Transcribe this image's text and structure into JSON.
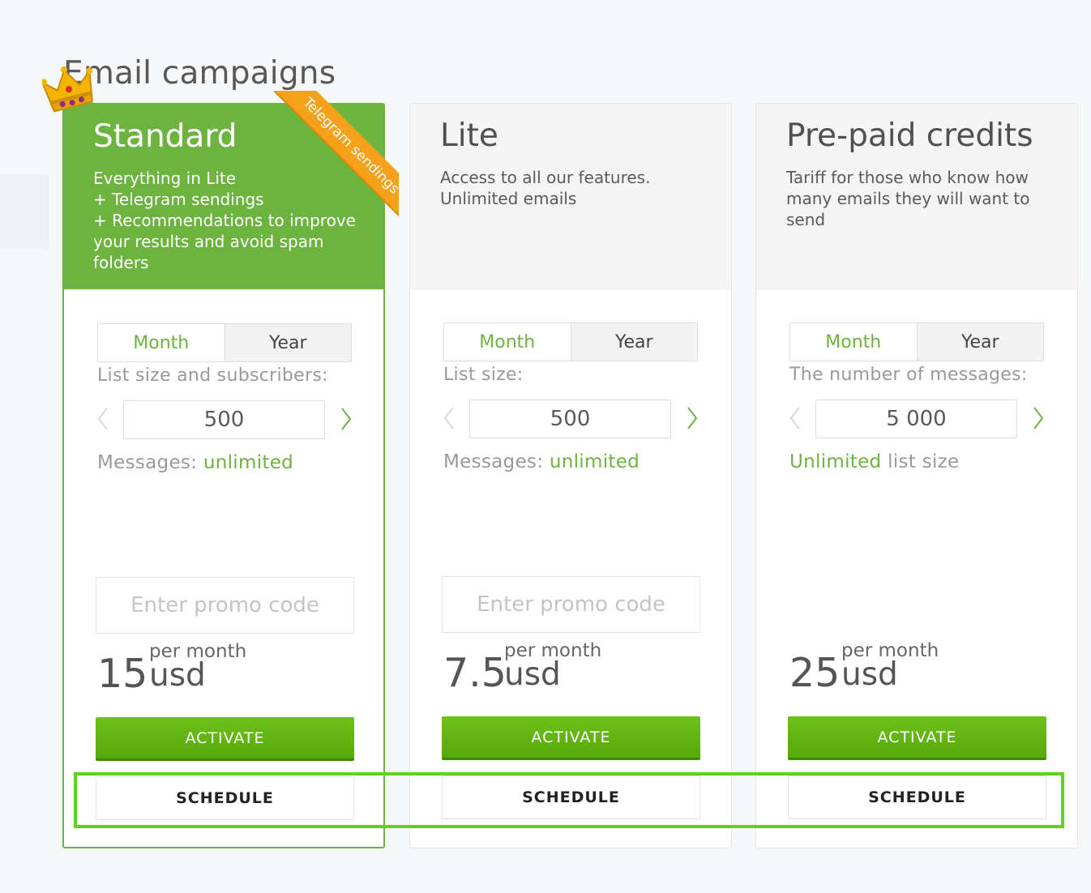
{
  "page": {
    "title": "Email campaigns"
  },
  "ribbon": {
    "text": "Telegram sendings"
  },
  "colors": {
    "accent": "#6db33f",
    "ribbon": "#f6a11a",
    "button": "#5fb513",
    "highlight": "#5fd11e"
  },
  "plans": [
    {
      "name": "Standard",
      "description": "Everything in Lite\n+ Telegram sendings\n+ Recommendations to improve your results and avoid spam folders",
      "period_month": "Month",
      "period_year": "Year",
      "field_label": "List size and subscribers:",
      "value": "500",
      "meta_prefix": "Messages: ",
      "meta_highlight": "unlimited",
      "meta_suffix": "",
      "promo_placeholder": "Enter promo code",
      "amount": "15",
      "per": "per month",
      "currency": "usd",
      "activate": "ACTIVATE",
      "schedule": "SCHEDULE"
    },
    {
      "name": "Lite",
      "description": "Access to all our features.\nUnlimited emails",
      "period_month": "Month",
      "period_year": "Year",
      "field_label": "List size:",
      "value": "500",
      "meta_prefix": "Messages: ",
      "meta_highlight": "unlimited",
      "meta_suffix": "",
      "promo_placeholder": "Enter promo code",
      "amount": "7.5",
      "per": "per month",
      "currency": "usd",
      "activate": "ACTIVATE",
      "schedule": "SCHEDULE"
    },
    {
      "name": "Pre-paid credits",
      "description": "Tariff for those who know how many emails they will want to send",
      "period_month": "Month",
      "period_year": "Year",
      "field_label": "The number of messages:",
      "value": "5 000",
      "meta_prefix": "",
      "meta_highlight": "Unlimited",
      "meta_suffix": " list size",
      "promo_placeholder": "",
      "amount": "25",
      "per": "per month",
      "currency": "usd",
      "activate": "ACTIVATE",
      "schedule": "SCHEDULE"
    }
  ]
}
